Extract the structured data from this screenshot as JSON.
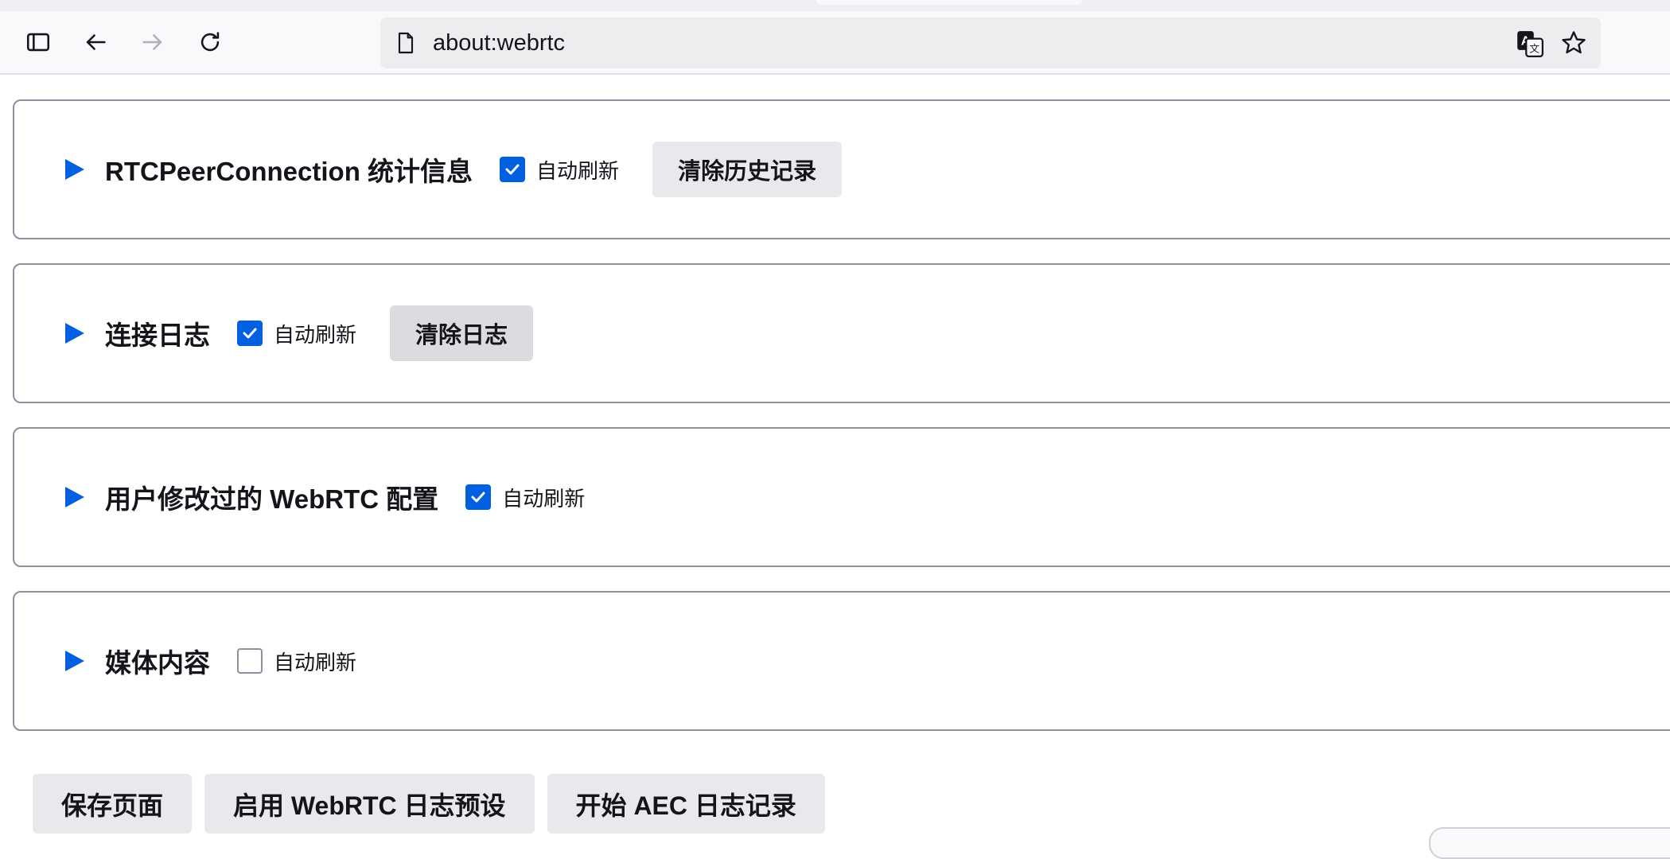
{
  "browser": {
    "url": "about:webrtc",
    "icons": {
      "sidebar": "sidebar-icon",
      "back": "back-arrow-icon",
      "forward": "forward-arrow-icon",
      "reload": "reload-icon",
      "page": "page-icon",
      "translate": "translate-icon",
      "bookmark": "star-icon"
    }
  },
  "sections": [
    {
      "title": "RTCPeerConnection 统计信息",
      "autorefresh_label": "自动刷新",
      "autorefresh_checked": true,
      "button_label": "清除历史记录"
    },
    {
      "title": "连接日志",
      "autorefresh_label": "自动刷新",
      "autorefresh_checked": true,
      "button_label": "清除日志"
    },
    {
      "title": "用户修改过的 WebRTC 配置",
      "autorefresh_label": "自动刷新",
      "autorefresh_checked": true
    },
    {
      "title": "媒体内容",
      "autorefresh_label": "自动刷新",
      "autorefresh_checked": false
    }
  ],
  "footer": {
    "save_page": "保存页面",
    "enable_log_preset": "启用 WebRTC 日志预设",
    "start_aec_log": "开始 AEC 日志记录"
  },
  "colors": {
    "accent": "#0060df",
    "button_bg": "#e9e9ed",
    "border": "#8f8f9d"
  }
}
